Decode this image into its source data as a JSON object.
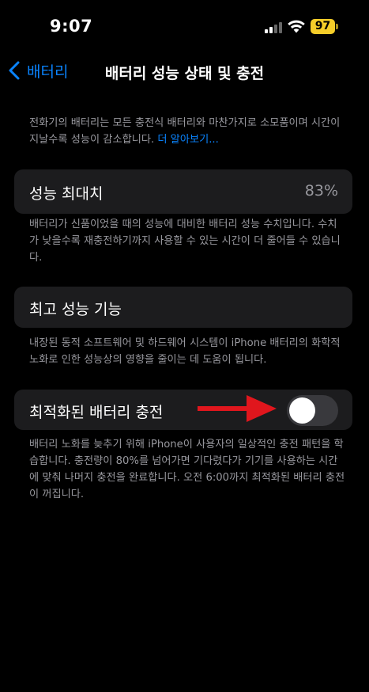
{
  "status_bar": {
    "time": "9:07",
    "battery_level": "97",
    "battery_color": "#f5cd29"
  },
  "nav": {
    "back_label": "배터리",
    "title": "배터리 성능 상태 및 충전"
  },
  "intro": {
    "text": "전화기의 배터리는 모든 충전식 배터리와 마찬가지로 소모품이며 시간이 지날수록 성능이 감소합니다. ",
    "link": "더 알아보기..."
  },
  "max_capacity": {
    "label": "성능 최대치",
    "value": "83%",
    "footnote": "배터리가 신품이었을 때의 성능에 대비한 배터리 성능 수치입니다. 수치가 낮을수록 재충전하기까지 사용할 수 있는 시간이 더 줄어들 수 있습니다."
  },
  "peak_performance": {
    "label": "최고 성능 기능",
    "footnote": "내장된 동적 소프트웨어 및 하드웨어 시스템이 iPhone 배터리의 화학적 노화로 인한 성능상의 영향을 줄이는 데 도움이 됩니다."
  },
  "optimized_charging": {
    "label": "최적화된 배터리 충전",
    "enabled": false,
    "footnote": "배터리 노화를 늦추기 위해 iPhone이 사용자의 일상적인 충전 패턴을 학습합니다. 충전량이 80%를 넘어가면 기다렸다가 기기를 사용하는 시간에 맞춰 나머지 충전을 완료합니다. 오전 6:00까지 최적화된 배터리 충전이 꺼집니다."
  },
  "colors": {
    "accent": "#0a84ff",
    "annotation_arrow": "#e0161d",
    "cell_bg": "#1c1c1e"
  }
}
